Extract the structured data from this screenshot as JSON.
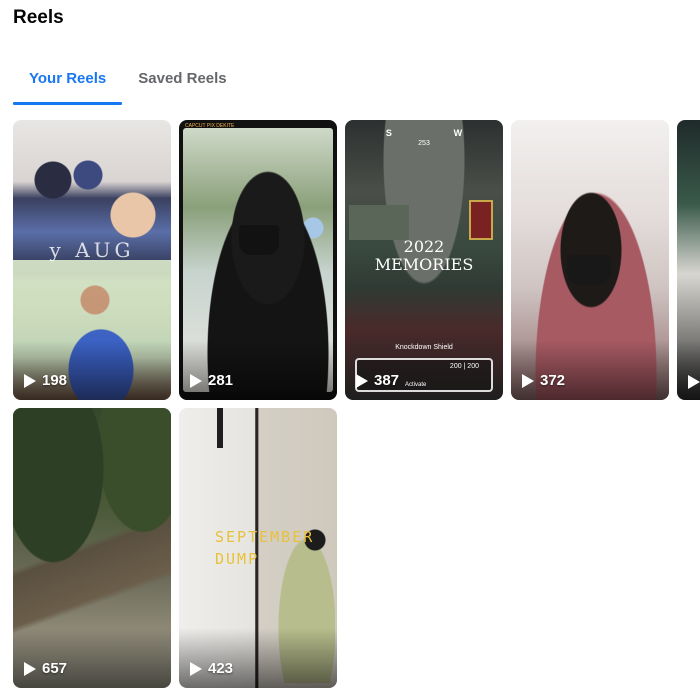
{
  "page": {
    "title": "Reels"
  },
  "tabs": [
    {
      "label": "Your Reels",
      "active": true
    },
    {
      "label": "Saved Reels",
      "active": false
    }
  ],
  "reels": [
    {
      "views": "198",
      "overlay_text": "y   AUG"
    },
    {
      "views": "281",
      "overlay_text": "CAPCUT  PIX DEKITE"
    },
    {
      "views": "387",
      "overlay_text": "2022 MEMORIES",
      "hud": {
        "label": "Knockdown Shield",
        "value": "200 | 200",
        "sub": "Activate"
      },
      "compass": [
        "S",
        "W"
      ],
      "compass_num": "253"
    },
    {
      "views": "372"
    },
    {
      "views": ""
    },
    {
      "views": "657"
    },
    {
      "views": "423",
      "overlay_text": "SEPTEMBER DUMP"
    }
  ],
  "colors": {
    "accent": "#1877f2",
    "text_primary": "#050505",
    "text_secondary": "#65676b",
    "background": "#ffffff"
  }
}
